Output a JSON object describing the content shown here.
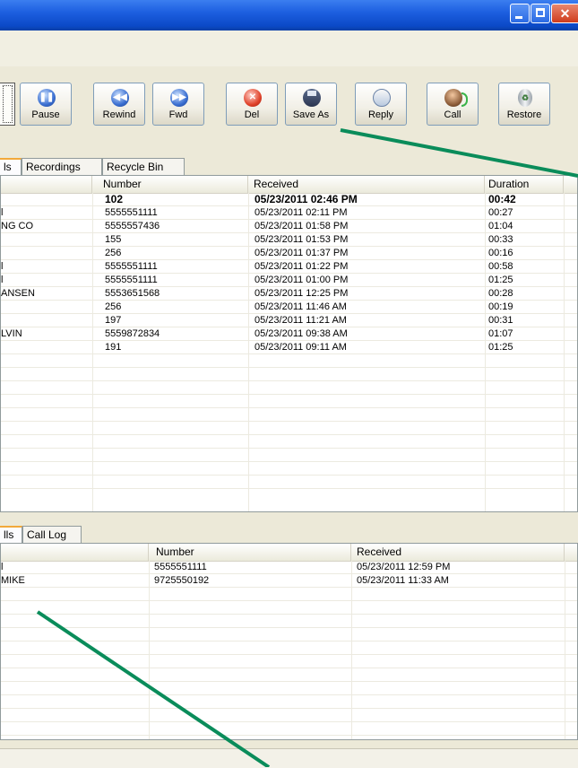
{
  "toolbar": {
    "buttons": [
      {
        "label": "Pause",
        "icon": "pause-icon"
      },
      {
        "label": "Rewind",
        "icon": "rewind-icon"
      },
      {
        "label": "Fwd",
        "icon": "forward-icon"
      },
      {
        "label": "Del",
        "icon": "delete-icon"
      },
      {
        "label": "Save As",
        "icon": "save-disk-icon"
      },
      {
        "label": "Reply",
        "icon": "reply-envelope-icon"
      },
      {
        "label": "Call",
        "icon": "call-person-icon"
      },
      {
        "label": "Restore",
        "icon": "recycle-bin-icon"
      }
    ]
  },
  "top_tabs": [
    "ls",
    "Recordings",
    "Recycle Bin"
  ],
  "top_table": {
    "columns": [
      "Number",
      "Received",
      "Duration"
    ],
    "rows": [
      {
        "name": "",
        "number": "102",
        "received": "05/23/2011 02:46 PM",
        "duration": "00:42",
        "bold": true
      },
      {
        "name": "l",
        "number": "5555551111",
        "received": "05/23/2011 02:11 PM",
        "duration": "00:27"
      },
      {
        "name": "NG CO",
        "number": "5555557436",
        "received": "05/23/2011 01:58 PM",
        "duration": "01:04"
      },
      {
        "name": "",
        "number": "155",
        "received": "05/23/2011 01:53 PM",
        "duration": "00:33"
      },
      {
        "name": "",
        "number": "256",
        "received": "05/23/2011 01:37 PM",
        "duration": "00:16"
      },
      {
        "name": "l",
        "number": "5555551111",
        "received": "05/23/2011 01:22 PM",
        "duration": "00:58"
      },
      {
        "name": "l",
        "number": "5555551111",
        "received": "05/23/2011 01:00 PM",
        "duration": "01:25"
      },
      {
        "name": "ANSEN",
        "number": "5553651568",
        "received": "05/23/2011 12:25 PM",
        "duration": "00:28"
      },
      {
        "name": "",
        "number": "256",
        "received": "05/23/2011 11:46 AM",
        "duration": "00:19"
      },
      {
        "name": "",
        "number": "197",
        "received": "05/23/2011 11:21 AM",
        "duration": "00:31"
      },
      {
        "name": "LVIN",
        "number": "5559872834",
        "received": "05/23/2011 09:38 AM",
        "duration": "01:07"
      },
      {
        "name": "",
        "number": "191",
        "received": "05/23/2011 09:11 AM",
        "duration": "01:25"
      }
    ]
  },
  "bottom_tabs": [
    "lls",
    "Call Log"
  ],
  "bottom_table": {
    "columns": [
      "Number",
      "Received"
    ],
    "rows": [
      {
        "name": "l",
        "number": "5555551111",
        "received": "05/23/2011 12:59 PM"
      },
      {
        "name": "MIKE",
        "number": "9725550192",
        "received": "05/23/2011 11:33 AM"
      }
    ]
  },
  "colors": {
    "titlebar": "#0b49c7",
    "annotation_arrow": "#0a8c5a",
    "active_tab_highlight": "#f2a93b"
  }
}
